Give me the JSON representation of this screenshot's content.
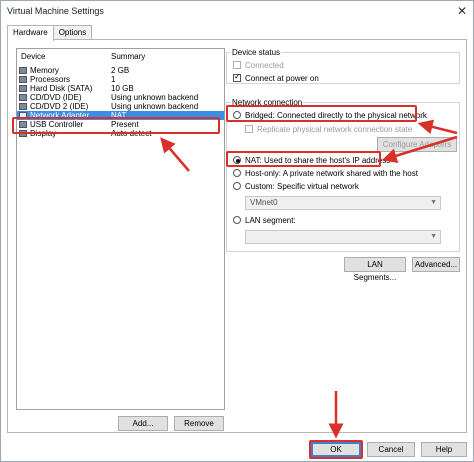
{
  "window": {
    "title": "Virtual Machine Settings",
    "close_glyph": "✕"
  },
  "tabs": [
    {
      "label": "Hardware"
    },
    {
      "label": "Options"
    }
  ],
  "device_list": {
    "col_device": "Device",
    "col_summary": "Summary",
    "rows": [
      {
        "name": "Memory",
        "summary": "2 GB"
      },
      {
        "name": "Processors",
        "summary": "1"
      },
      {
        "name": "Hard Disk (SATA)",
        "summary": "10 GB"
      },
      {
        "name": "CD/DVD (IDE)",
        "summary": "Using unknown backend"
      },
      {
        "name": "CD/DVD 2 (IDE)",
        "summary": "Using unknown backend"
      },
      {
        "name": "Network Adapter",
        "summary": "NAT"
      },
      {
        "name": "USB Controller",
        "summary": "Present"
      },
      {
        "name": "Display",
        "summary": "Auto detect"
      }
    ],
    "selected_index": 5
  },
  "buttons": {
    "add": "Add...",
    "remove": "Remove",
    "ok": "OK",
    "cancel": "Cancel",
    "help": "Help"
  },
  "device_status": {
    "title": "Device status",
    "connected": "Connected",
    "connect_at_power_on": "Connect at power on"
  },
  "network_connection": {
    "title": "Network connection",
    "bridged": "Bridged: Connected directly to the physical network",
    "replicate": "Replicate physical network connection state",
    "configure_adapters": "Configure Adapters",
    "nat": "NAT: Used to share the host's IP address",
    "host_only": "Host-only: A private network shared with the host",
    "custom": "Custom: Specific virtual network",
    "custom_value": "VMnet0",
    "lan_segment": "LAN segment:",
    "lan_segment_value": "",
    "selected": "nat"
  },
  "network_buttons": {
    "lan_segments": "LAN Segments...",
    "advanced": "Advanced..."
  },
  "annotation_color": "#d9312a"
}
